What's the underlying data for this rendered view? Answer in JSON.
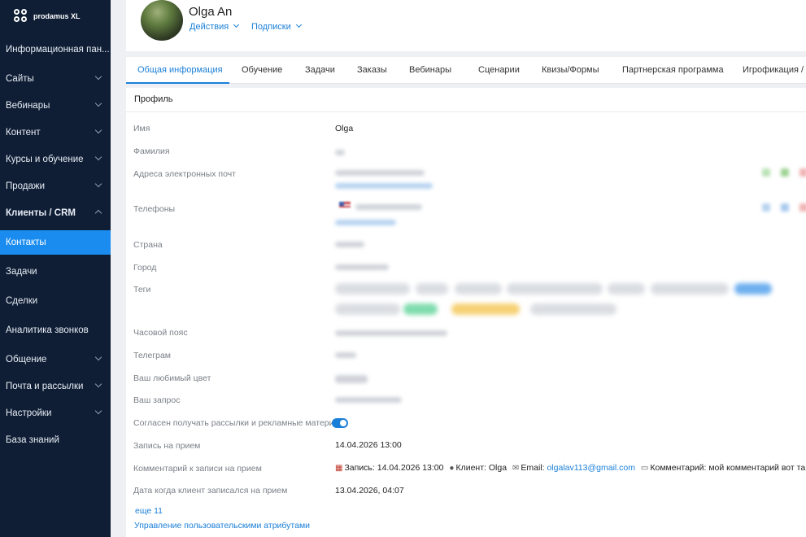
{
  "sidebar": {
    "brand": "prodamus XL",
    "items": [
      {
        "label": "Информационная пан..."
      },
      {
        "label": "Сайты"
      },
      {
        "label": "Вебинары"
      },
      {
        "label": "Контент"
      },
      {
        "label": "Курсы и обучение"
      },
      {
        "label": "Продажи"
      },
      {
        "label": "Клиенты / CRM"
      },
      {
        "label": "Контакты"
      },
      {
        "label": "Задачи"
      },
      {
        "label": "Сделки"
      },
      {
        "label": "Аналитика звонков"
      },
      {
        "label": "Общение"
      },
      {
        "label": "Почта и рассылки"
      },
      {
        "label": "Настройки"
      },
      {
        "label": "База знаний"
      }
    ]
  },
  "header": {
    "name": "Olga An",
    "actions": "Действия",
    "subscriptions": "Подписки"
  },
  "tabs": [
    "Общая информация",
    "Обучение",
    "Задачи",
    "Заказы",
    "Вебинары",
    "Сценарии",
    "Квизы/Формы",
    "Партнерская программа",
    "Игрофикация /"
  ],
  "profile": {
    "section_title": "Профиль",
    "fields": {
      "first_name_label": "Имя",
      "first_name_value": "Olga",
      "last_name_label": "Фамилия",
      "emails_label": "Адреса электронных почт",
      "phones_label": "Телефоны",
      "country_label": "Страна",
      "city_label": "Город",
      "tags_label": "Теги",
      "timezone_label": "Часовой пояс",
      "telegram_label": "Телеграм",
      "fav_color_label": "Ваш любимый цвет",
      "request_label": "Ваш запрос",
      "consent_label": "Согласен получать рассылки и рекламные матери",
      "appointment_label": "Запись на прием",
      "appointment_value": "14.04.2026 13:00",
      "comment_label": "Комментарий к записи на прием",
      "comment": {
        "record": "Запись: 14.04.2026 13:00",
        "client": "Клиент: Olga",
        "email_label": "Email:",
        "email": "olgalav113@gmail.com",
        "comment_text": "Комментарий: мой комментарий вот та"
      },
      "signup_date_label": "Дата когда клиент записался на прием",
      "signup_date_value": "13.04.2026, 04:07"
    },
    "consent_enabled": true,
    "more_link": "еще 11",
    "manage_attributes_link": "Управление пользовательскими атрибутами"
  },
  "colors": {
    "sidebar_bg": "#0f1e35",
    "accent": "#1a8cf0",
    "link": "#1a7fd8"
  }
}
